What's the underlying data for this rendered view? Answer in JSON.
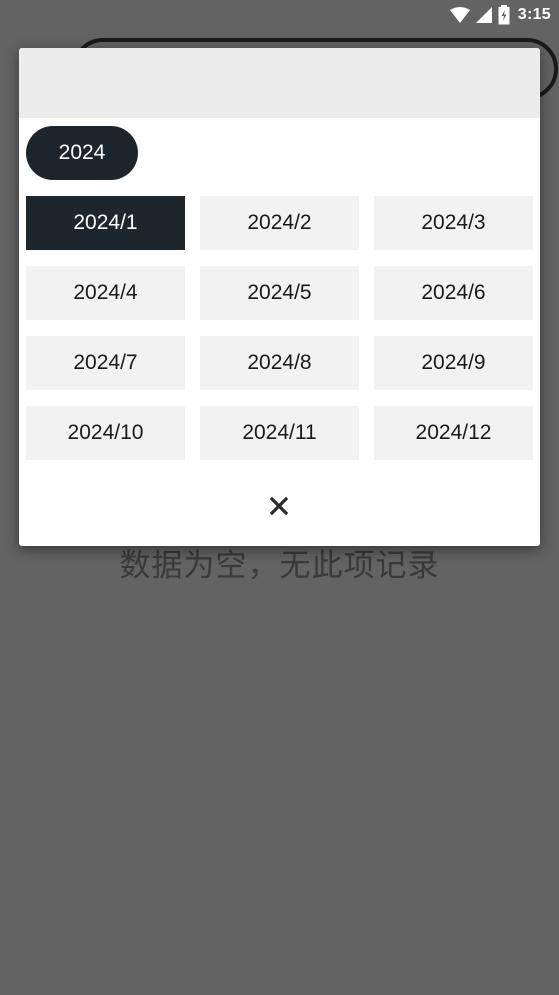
{
  "status_bar": {
    "time": "3:15",
    "icons": [
      "wifi-icon",
      "signal-icon",
      "battery-icon"
    ]
  },
  "background": {
    "empty_message": "数据为空，无此项记录"
  },
  "dialog": {
    "year_label": "2024",
    "selected_month": "2024/1",
    "months": [
      "2024/1",
      "2024/2",
      "2024/3",
      "2024/4",
      "2024/5",
      "2024/6",
      "2024/7",
      "2024/8",
      "2024/9",
      "2024/10",
      "2024/11",
      "2024/12"
    ],
    "close_icon": "close-icon"
  },
  "colors": {
    "overlay": "#636363",
    "accent_dark": "#1e262d",
    "cell_bg": "#f2f2f2",
    "header_bg": "#ececec"
  }
}
